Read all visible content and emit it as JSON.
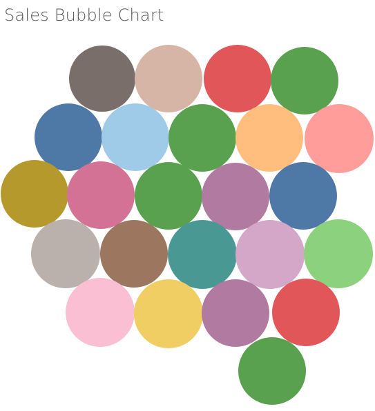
{
  "chart_data": {
    "type": "bubble",
    "title": "Sales Bubble Chart",
    "legend": "none",
    "bubbles": [
      {
        "color": "#7a6e6b"
      },
      {
        "color": "#d7b5a6"
      },
      {
        "color": "#e15759"
      },
      {
        "color": "#59a14f"
      },
      {
        "color": "#4e79a7"
      },
      {
        "color": "#a0cbe8"
      },
      {
        "color": "#59a14f"
      },
      {
        "color": "#ffbe7d"
      },
      {
        "color": "#ff9d9a"
      },
      {
        "color": "#b6992d"
      },
      {
        "color": "#d37295"
      },
      {
        "color": "#59a14f"
      },
      {
        "color": "#b07aa1"
      },
      {
        "color": "#4e79a7"
      },
      {
        "color": "#bab0ac"
      },
      {
        "color": "#9d7660"
      },
      {
        "color": "#499894"
      },
      {
        "color": "#d4a6c8"
      },
      {
        "color": "#8cd17d"
      },
      {
        "color": "#fabfd2"
      },
      {
        "color": "#f1ce63"
      },
      {
        "color": "#b07aa1"
      },
      {
        "color": "#e15759"
      },
      {
        "color": "#59a14f"
      }
    ]
  }
}
